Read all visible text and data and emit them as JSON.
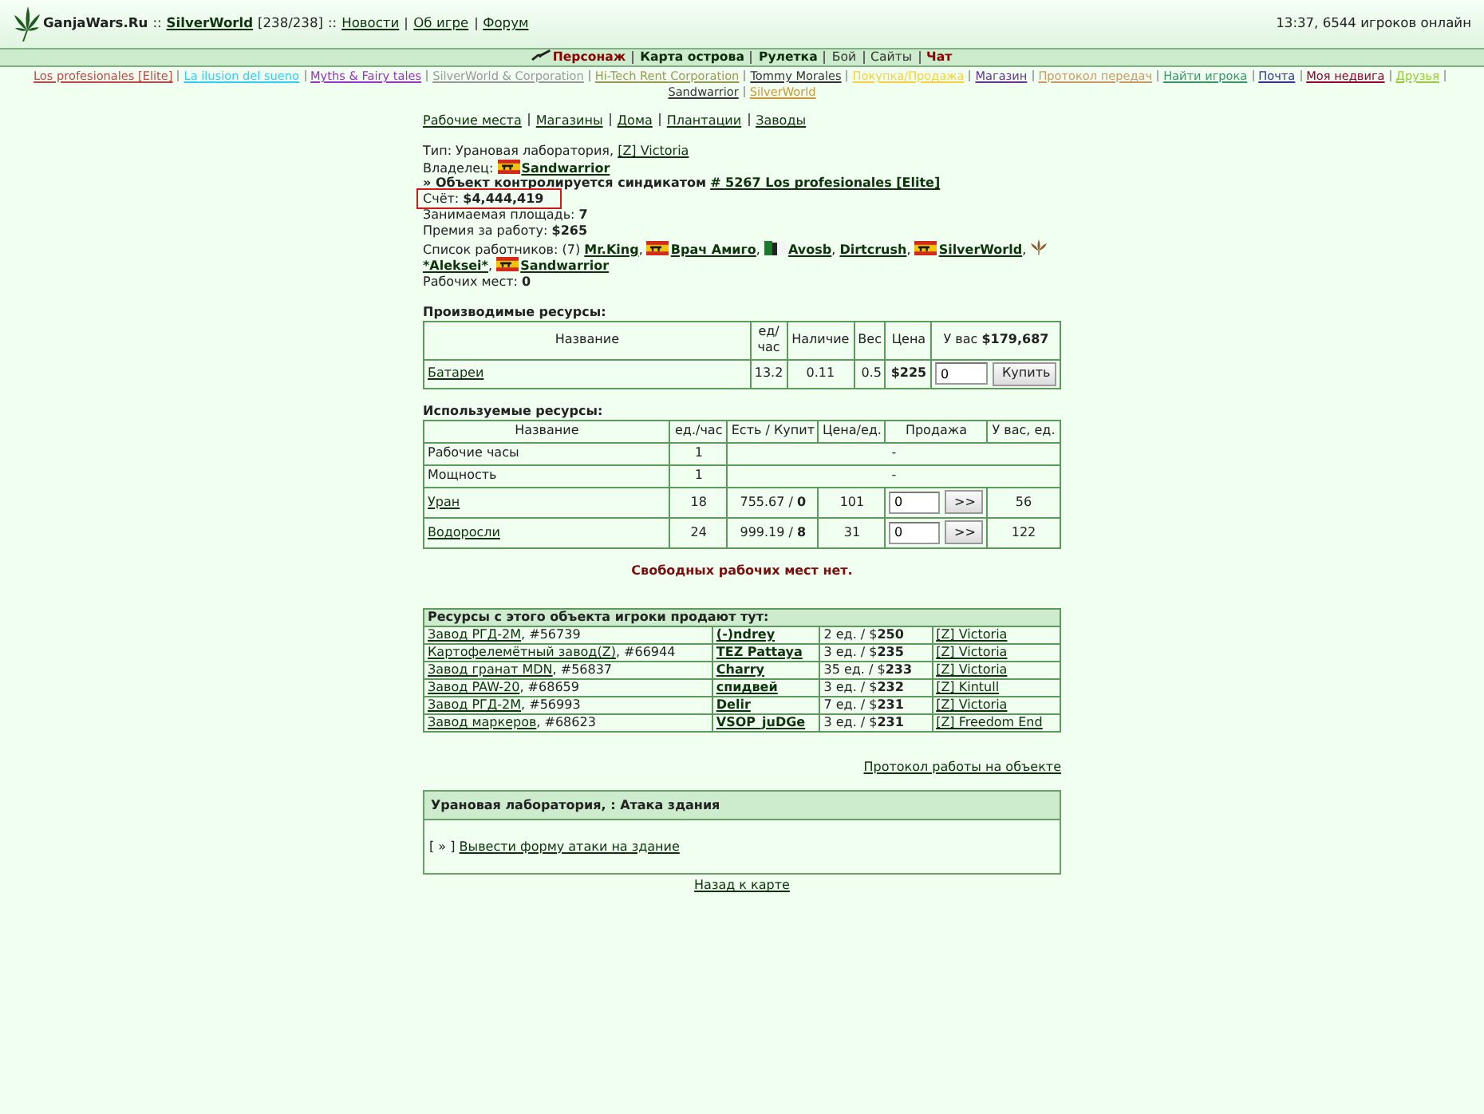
{
  "header": {
    "site": "GanjaWars.Ru",
    "separator_1": "::",
    "world": "SilverWorld",
    "online_count": "[238/238]",
    "separator_2": "::",
    "links": [
      "Новости",
      "Об игре",
      "Форум"
    ],
    "status": "13:37, 6544 игроков онлайн"
  },
  "menu": [
    {
      "label": "Персонаж",
      "kind": "character"
    },
    {
      "label": "Карта острова",
      "kind": "bold"
    },
    {
      "label": "Рулетка",
      "kind": "bold"
    },
    {
      "label": "Бой",
      "kind": "plain"
    },
    {
      "label": "Сайты",
      "kind": "plain"
    },
    {
      "label": "Чат",
      "kind": "alert"
    }
  ],
  "quick_links": [
    {
      "label": "Los profesionales [Elite]",
      "color": "#c04848"
    },
    {
      "label": "La ilusion del sueno",
      "color": "#33ccff"
    },
    {
      "label": "Myths & Fairy tales",
      "color": "#9933cc"
    },
    {
      "label": "SilverWorld & Corporation",
      "color": "#999999"
    },
    {
      "label": "Hi-Tech Rent Corporation",
      "color": "#999955"
    },
    {
      "label": "Tommy Morales",
      "color": "#333333"
    },
    {
      "label": "Покупка/Продажа",
      "color": "#f5d142"
    },
    {
      "label": "Магазин",
      "color": "#663399"
    },
    {
      "label": "Протокол передач",
      "color": "#cc9966"
    },
    {
      "label": "Найти игрока",
      "color": "#339966"
    },
    {
      "label": "Почта",
      "color": "#333399"
    },
    {
      "label": "Моя недвига",
      "color": "#990033"
    },
    {
      "label": "Друзья",
      "color": "#99cc33"
    },
    {
      "label": "Sandwarrior",
      "color": "#333333"
    },
    {
      "label": "SilverWorld",
      "color": "#cc9933"
    }
  ],
  "sections": [
    "Рабочие места",
    "Магазины",
    "Дома",
    "Плантации",
    "Заводы"
  ],
  "object": {
    "type_text": "Тип: Урановая лаборатория,",
    "island": "[Z] Victoria",
    "owner_label": "Владелец:",
    "owner": {
      "name": "Sandwarrior",
      "kind": "flag"
    },
    "control_text": "» Объект контролируется синдикатом",
    "syndicate": "# 5267 Los profesionales [Elite]",
    "stats": [
      {
        "text": "Счёт: **$4,444,419**",
        "highlighted": true
      },
      {
        "text": "Занимаемая площадь: **7**",
        "highlighted": false
      },
      {
        "text": "Премия за работу: **$265**",
        "highlighted": false
      }
    ],
    "workers_label": "Список работников: (7)",
    "workers": [
      {
        "name": "Mr.King",
        "kind": "plain",
        "trail": ","
      },
      {
        "name": "Врач Амиго",
        "kind": "flag",
        "trail": ","
      },
      {
        "name": "Avosb",
        "kind": "tricolor",
        "trail": ","
      },
      {
        "name": "Dirtcrush",
        "kind": "plain",
        "trail": ","
      },
      {
        "name": "SilverWorld",
        "kind": "flag",
        "trail": ","
      },
      {
        "name": "*Aleksei*",
        "kind": "leaf",
        "trail": ","
      },
      {
        "name": "Sandwarrior",
        "kind": "flag"
      }
    ],
    "places": {
      "text": "Рабочих мест: **0**"
    }
  },
  "produced": {
    "title": "Производимые ресурсы:",
    "columns": [
      "Название",
      "ед/ час",
      "Наличие",
      "Вес",
      "Цена",
      "У вас **$179,687**"
    ],
    "rows": [
      {
        "name": "Батареи",
        "rate": "13.2",
        "stock": "0.11",
        "weight": "0.5",
        "price": "$225",
        "quantity": "0",
        "action": "Купить"
      }
    ]
  },
  "used": {
    "title": "Используемые ресурсы:",
    "columns": [
      "Название",
      "ед./час",
      "Есть / Купит",
      "Цена/ед.",
      "Продажа",
      "У вас, ед."
    ],
    "rows": [
      {
        "kind": "fixed",
        "name": "Рабочие часы",
        "rate": "1",
        "note": "-"
      },
      {
        "kind": "fixed",
        "name": "Мощность",
        "rate": "1",
        "note": "-"
      },
      {
        "kind": "resource",
        "name": "Уран",
        "rate": "18",
        "stock": "755.67 / **0**",
        "price": "101",
        "quantity": "0",
        "action": ">>",
        "owned": "56"
      },
      {
        "kind": "resource",
        "name": "Водоросли",
        "rate": "24",
        "stock": "999.19 / **8**",
        "price": "31",
        "quantity": "0",
        "action": ">>",
        "owned": "122"
      }
    ]
  },
  "notice": "Свободных рабочих мест нет.",
  "sellers": {
    "title": "Ресурсы с этого объекта игроки продают тут:",
    "rows": [
      {
        "factory": "Завод РГД-2М",
        "suffix": ", #56739",
        "seller": "(-)ndrey",
        "offer": "2 ед. / $**250**",
        "island": "[Z] Victoria"
      },
      {
        "factory": "Картофелемётный завод(Z)",
        "suffix": ", #66944",
        "seller": "TEZ Pattaya",
        "offer": "3 ед. / $**235**",
        "island": "[Z] Victoria"
      },
      {
        "factory": "Завод гранат MDN",
        "suffix": ", #56837",
        "seller": "Charry",
        "offer": "35 ед. / $**233**",
        "island": "[Z] Victoria"
      },
      {
        "factory": "Завод PAW-20",
        "suffix": ", #68659",
        "seller": "спидвей",
        "offer": "3 ед. / $**232**",
        "island": "[Z] Kintull"
      },
      {
        "factory": "Завод РГД-2М",
        "suffix": ", #56993",
        "seller": "Delir",
        "offer": "7 ед. / $**231**",
        "island": "[Z] Victoria"
      },
      {
        "factory": "Завод маркеров",
        "suffix": ", #68623",
        "seller": "VSOP_juDGe",
        "offer": "3 ед. / $**231**",
        "island": "[Z] Freedom End"
      }
    ]
  },
  "protocol_link": "Протокол работы на объекте",
  "attack": {
    "title": "Урановая лаборатория, : Атака здания",
    "prefix": "[ » ]",
    "link": "Вывести форму атаки на здание"
  },
  "back_link": "Назад к карте"
}
